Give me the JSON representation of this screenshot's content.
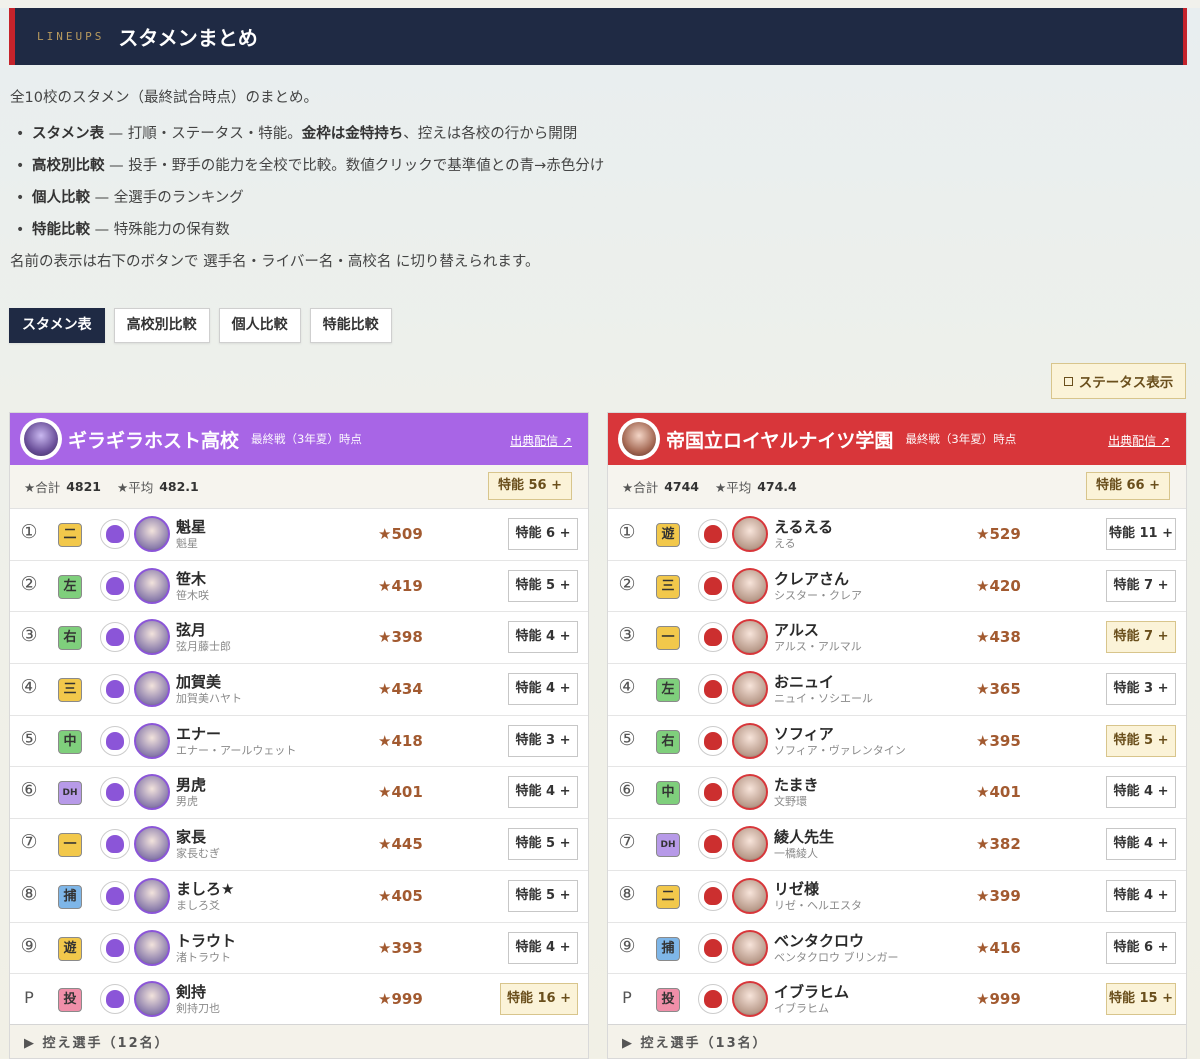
{
  "header": {
    "kicker": "LINEUPS",
    "title": "スタメンまとめ"
  },
  "intro": {
    "lead": "全10校のスタメン（最終試合時点）のまとめ。",
    "items": [
      {
        "title": "スタメン表",
        "text": " — 打順・ステータス・特能。",
        "bold2": "金枠は金特持ち",
        "text2": "、控えは各校の行から開閉"
      },
      {
        "title": "高校別比較",
        "text": " — 投手・野手の能力を全校で比較。数値クリックで基準値との青→赤色分け",
        "bold2": "",
        "text2": ""
      },
      {
        "title": "個人比較",
        "text": " — 全選手のランキング",
        "bold2": "",
        "text2": ""
      },
      {
        "title": "特能比較",
        "text": " — 特殊能力の保有数",
        "bold2": "",
        "text2": ""
      }
    ],
    "note": "名前の表示は右下のボタンで 選手名・ライバー名・高校名 に切り替えられます。"
  },
  "tabs": [
    "スタメン表",
    "高校別比較",
    "個人比較",
    "特能比較"
  ],
  "status_toggle": "ステータス表示",
  "teams": [
    {
      "school": "ギラギラホスト高校",
      "when": "最終戦（3年夏）時点",
      "source": "出典配信 ↗",
      "total_label": "★合計",
      "total": "4821",
      "avg_label": "★平均",
      "avg": "482.1",
      "traits_total": "特能 56 +",
      "players": [
        {
          "order": "①",
          "pos": "二",
          "color": "c-yellow",
          "name": "魁星",
          "sub": "魁星",
          "rating": "★509",
          "traits": "特能 6 +",
          "gold": false
        },
        {
          "order": "②",
          "pos": "左",
          "color": "c-green",
          "name": "笹木",
          "sub": "笹木咲",
          "rating": "★419",
          "traits": "特能 5 +",
          "gold": false
        },
        {
          "order": "③",
          "pos": "右",
          "color": "c-green",
          "name": "弦月",
          "sub": "弦月藤士郎",
          "rating": "★398",
          "traits": "特能 4 +",
          "gold": false
        },
        {
          "order": "④",
          "pos": "三",
          "color": "c-yellow",
          "name": "加賀美",
          "sub": "加賀美ハヤト",
          "rating": "★434",
          "traits": "特能 4 +",
          "gold": false
        },
        {
          "order": "⑤",
          "pos": "中",
          "color": "c-green",
          "name": "エナー",
          "sub": "エナー・アールウェット",
          "rating": "★418",
          "traits": "特能 3 +",
          "gold": false
        },
        {
          "order": "⑥",
          "pos": "DH",
          "color": "c-purple",
          "name": "男虎",
          "sub": "男虎",
          "rating": "★401",
          "traits": "特能 4 +",
          "gold": false
        },
        {
          "order": "⑦",
          "pos": "一",
          "color": "c-yellow",
          "name": "家長",
          "sub": "家長むぎ",
          "rating": "★445",
          "traits": "特能 5 +",
          "gold": false
        },
        {
          "order": "⑧",
          "pos": "捕",
          "color": "c-blue",
          "name": "ましろ★",
          "sub": "ましろ爻",
          "rating": "★405",
          "traits": "特能 5 +",
          "gold": false
        },
        {
          "order": "⑨",
          "pos": "遊",
          "color": "c-yellow",
          "name": "トラウト",
          "sub": "渚トラウト",
          "rating": "★393",
          "traits": "特能 4 +",
          "gold": false
        },
        {
          "order": "P",
          "pos": "投",
          "color": "c-pink",
          "name": "剣持",
          "sub": "剣持刀也",
          "rating": "★999",
          "traits": "特能 16 +",
          "gold": true
        }
      ],
      "bench": "控え選手（12名）"
    },
    {
      "school": "帝国立ロイヤルナイツ学園",
      "when": "最終戦（3年夏）時点",
      "source": "出典配信 ↗",
      "total_label": "★合計",
      "total": "4744",
      "avg_label": "★平均",
      "avg": "474.4",
      "traits_total": "特能 66 +",
      "players": [
        {
          "order": "①",
          "pos": "遊",
          "color": "c-yellow",
          "name": "えるえる",
          "sub": "える",
          "rating": "★529",
          "traits": "特能 11 +",
          "gold": false
        },
        {
          "order": "②",
          "pos": "三",
          "color": "c-yellow",
          "name": "クレアさん",
          "sub": "シスター・クレア",
          "rating": "★420",
          "traits": "特能 7 +",
          "gold": false
        },
        {
          "order": "③",
          "pos": "一",
          "color": "c-yellow",
          "name": "アルス",
          "sub": "アルス・アルマル",
          "rating": "★438",
          "traits": "特能 7 +",
          "gold": true
        },
        {
          "order": "④",
          "pos": "左",
          "color": "c-green",
          "name": "おニュイ",
          "sub": "ニュイ・ソシエール",
          "rating": "★365",
          "traits": "特能 3 +",
          "gold": false
        },
        {
          "order": "⑤",
          "pos": "右",
          "color": "c-green",
          "name": "ソフィア",
          "sub": "ソフィア・ヴァレンタイン",
          "rating": "★395",
          "traits": "特能 5 +",
          "gold": true
        },
        {
          "order": "⑥",
          "pos": "中",
          "color": "c-green",
          "name": "たまき",
          "sub": "文野環",
          "rating": "★401",
          "traits": "特能 4 +",
          "gold": false
        },
        {
          "order": "⑦",
          "pos": "DH",
          "color": "c-purple",
          "name": "綾人先生",
          "sub": "一橋綾人",
          "rating": "★382",
          "traits": "特能 4 +",
          "gold": false
        },
        {
          "order": "⑧",
          "pos": "二",
          "color": "c-yellow",
          "name": "リゼ様",
          "sub": "リゼ・ヘルエスタ",
          "rating": "★399",
          "traits": "特能 4 +",
          "gold": false
        },
        {
          "order": "⑨",
          "pos": "捕",
          "color": "c-blue",
          "name": "ベンタクロウ",
          "sub": "ベンタクロウ ブリンガー",
          "rating": "★416",
          "traits": "特能 6 +",
          "gold": false
        },
        {
          "order": "P",
          "pos": "投",
          "color": "c-pink",
          "name": "イブラヒム",
          "sub": "イブラヒム",
          "rating": "★999",
          "traits": "特能 15 +",
          "gold": true
        }
      ],
      "bench": "控え選手（13名）"
    }
  ]
}
